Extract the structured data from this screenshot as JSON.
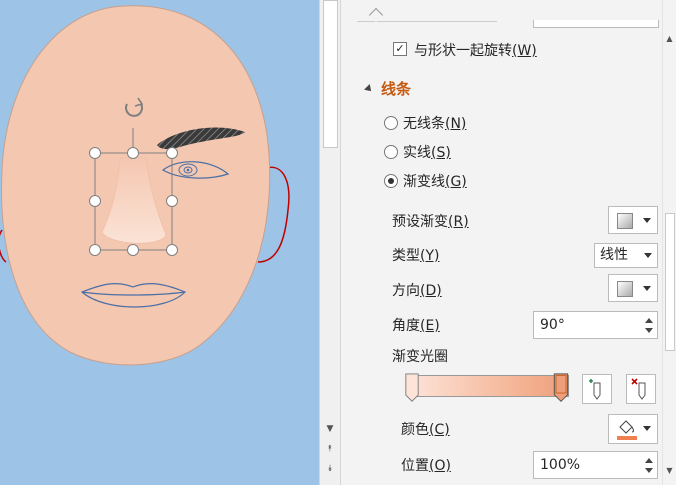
{
  "pane": {
    "rotate_with_shape": {
      "label": "与形状一起旋转",
      "key": "(W)",
      "checked": true
    },
    "section": {
      "title": "线条",
      "expanded": true
    },
    "line_options": [
      {
        "label": "无线条",
        "key": "(N)",
        "selected": false
      },
      {
        "label": "实线",
        "key": "(S)",
        "selected": false
      },
      {
        "label": "渐变线",
        "key": "(G)",
        "selected": true
      }
    ],
    "preset_gradient": {
      "label": "预设渐变",
      "key": "(R)"
    },
    "type": {
      "label": "类型",
      "key": "(Y)",
      "value": "线性"
    },
    "direction": {
      "label": "方向",
      "key": "(D)"
    },
    "angle": {
      "label": "角度",
      "key": "(E)",
      "value": "90°"
    },
    "gradient_stops": {
      "label": "渐变光圈"
    },
    "color": {
      "label": "颜色",
      "key": "(C)"
    },
    "position": {
      "label": "位置",
      "key": "(O)",
      "value": "100%"
    }
  },
  "colors": {
    "canvas_bg": "#9dc3e6",
    "skin": "#f4c7b0",
    "accent": "#c55a11",
    "eye_outline": "#4a6fa5",
    "ear_outline": "#c00000",
    "fill_bucket_color": "#f08050"
  },
  "icons": {
    "rotate_handle": "rotate-icon",
    "add_stop": "add-gradient-stop-icon",
    "remove_stop": "remove-gradient-stop-icon",
    "fill_color": "paint-bucket-icon"
  }
}
